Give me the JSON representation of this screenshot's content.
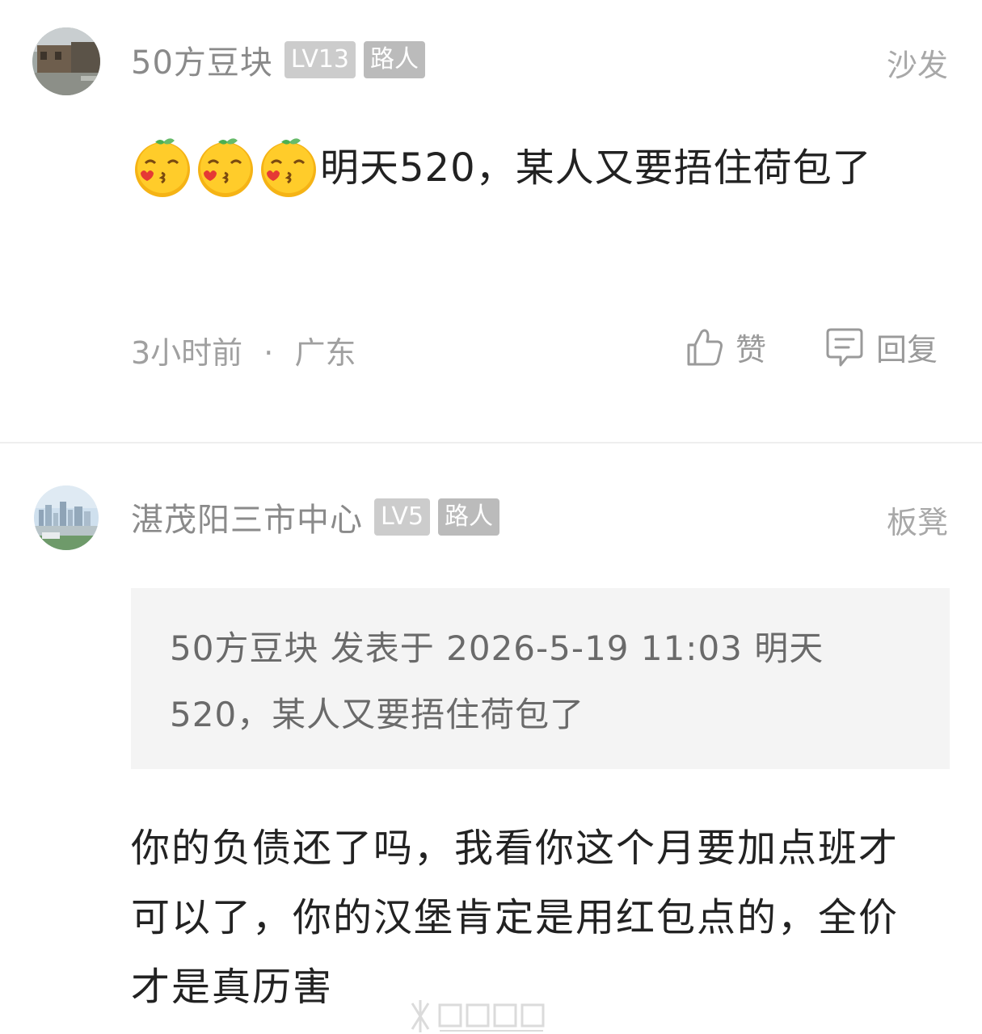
{
  "comments": [
    {
      "username": "50方豆块",
      "level": "LV13",
      "role": "路人",
      "floor": "沙发",
      "emoji_icon": "kiss-orange-emoji",
      "text": "明天520，某人又要捂住荷包了",
      "time": "3小时前",
      "separator": "·",
      "location": "广东",
      "like_label": "赞",
      "reply_label": "回复"
    },
    {
      "username": "湛茂阳三市中心",
      "level": "LV5",
      "role": "路人",
      "floor": "板凳",
      "quote": "50方豆块 发表于 2026-5-19 11:03 明天520，某人又要捂住荷包了",
      "text": "你的负债还了吗，我看你这个月要加点班才可以了，你的汉堡肯定是用红包点的，全价才是真历害"
    }
  ],
  "colors": {
    "username": "#8a8a8a",
    "level_badge": "#cccccc",
    "role_badge": "#bbbbbb",
    "quote_bg": "#f4f4f4",
    "divider": "#eeeeee"
  },
  "icons": {
    "like": "thumbs-up-icon",
    "reply": "comment-bubble-icon"
  }
}
